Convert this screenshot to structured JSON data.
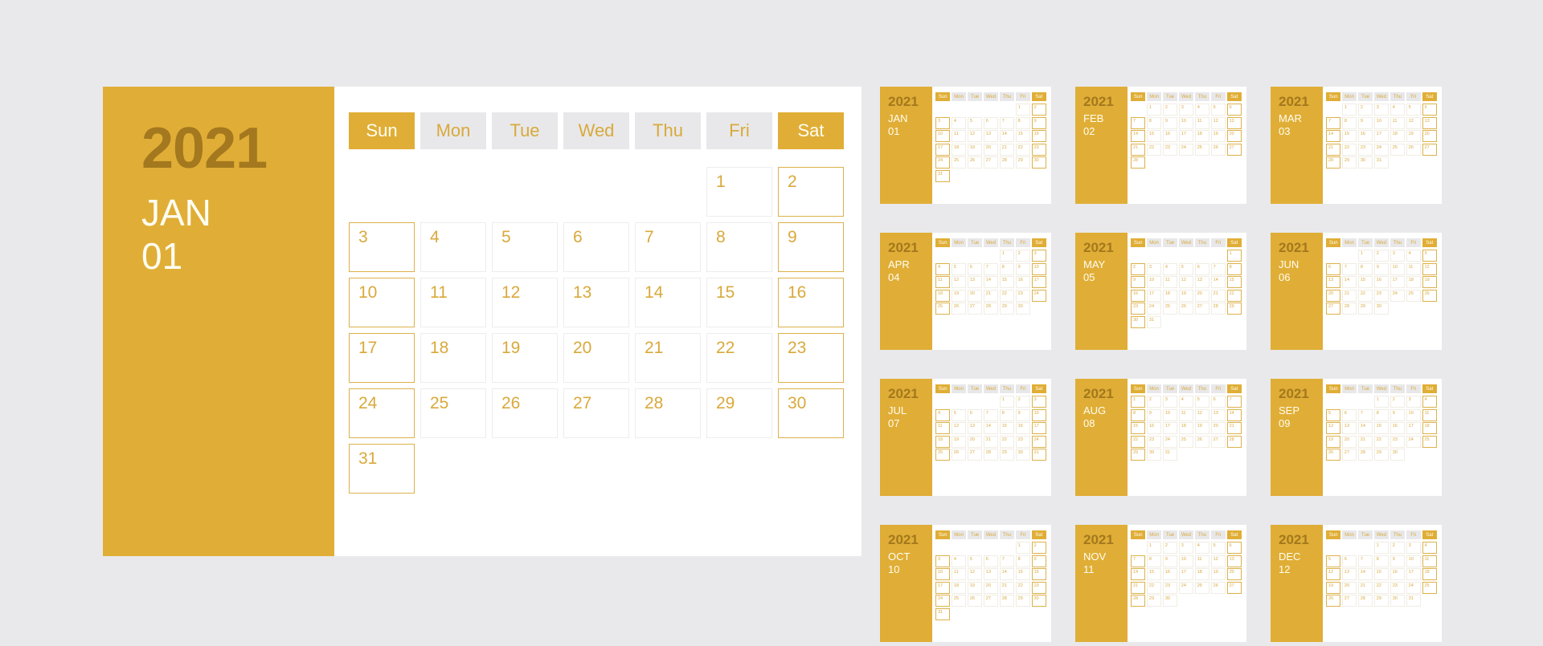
{
  "meta": {
    "year": "2021",
    "background_color": "#E9E9EB",
    "accent_color": "#E0AE36",
    "accent_dark_color": "#A3781E",
    "accent_text_color": "#D9A93B",
    "panel_color": "#FFFFFF",
    "weekday_bg_color": "#E8E8EA",
    "cell_border_color": "#EDEDEF",
    "cell_border_accent_color": "#DCB14A"
  },
  "weekdays": [
    "Sun",
    "Mon",
    "Tue",
    "Wed",
    "Thu",
    "Fri",
    "Sat"
  ],
  "weekdays_accent": [
    true,
    false,
    false,
    false,
    false,
    false,
    true
  ],
  "featured": {
    "year": "2021",
    "month_abbr": "JAN",
    "month_number": "01",
    "lead_blanks": 5,
    "days_in_month": 31
  },
  "months": [
    {
      "year": "2021",
      "abbr": "JAN",
      "num": "01",
      "lead_blanks": 5,
      "days": 31
    },
    {
      "year": "2021",
      "abbr": "FEB",
      "num": "02",
      "lead_blanks": 1,
      "days": 28
    },
    {
      "year": "2021",
      "abbr": "MAR",
      "num": "03",
      "lead_blanks": 1,
      "days": 31
    },
    {
      "year": "2021",
      "abbr": "APR",
      "num": "04",
      "lead_blanks": 4,
      "days": 30
    },
    {
      "year": "2021",
      "abbr": "MAY",
      "num": "05",
      "lead_blanks": 6,
      "days": 31
    },
    {
      "year": "2021",
      "abbr": "JUN",
      "num": "06",
      "lead_blanks": 2,
      "days": 30
    },
    {
      "year": "2021",
      "abbr": "JUL",
      "num": "07",
      "lead_blanks": 4,
      "days": 31
    },
    {
      "year": "2021",
      "abbr": "AUG",
      "num": "08",
      "lead_blanks": 0,
      "days": 31
    },
    {
      "year": "2021",
      "abbr": "SEP",
      "num": "09",
      "lead_blanks": 3,
      "days": 30
    },
    {
      "year": "2021",
      "abbr": "OCT",
      "num": "10",
      "lead_blanks": 5,
      "days": 31
    },
    {
      "year": "2021",
      "abbr": "NOV",
      "num": "11",
      "lead_blanks": 1,
      "days": 30
    },
    {
      "year": "2021",
      "abbr": "DEC",
      "num": "12",
      "lead_blanks": 3,
      "days": 31
    }
  ]
}
